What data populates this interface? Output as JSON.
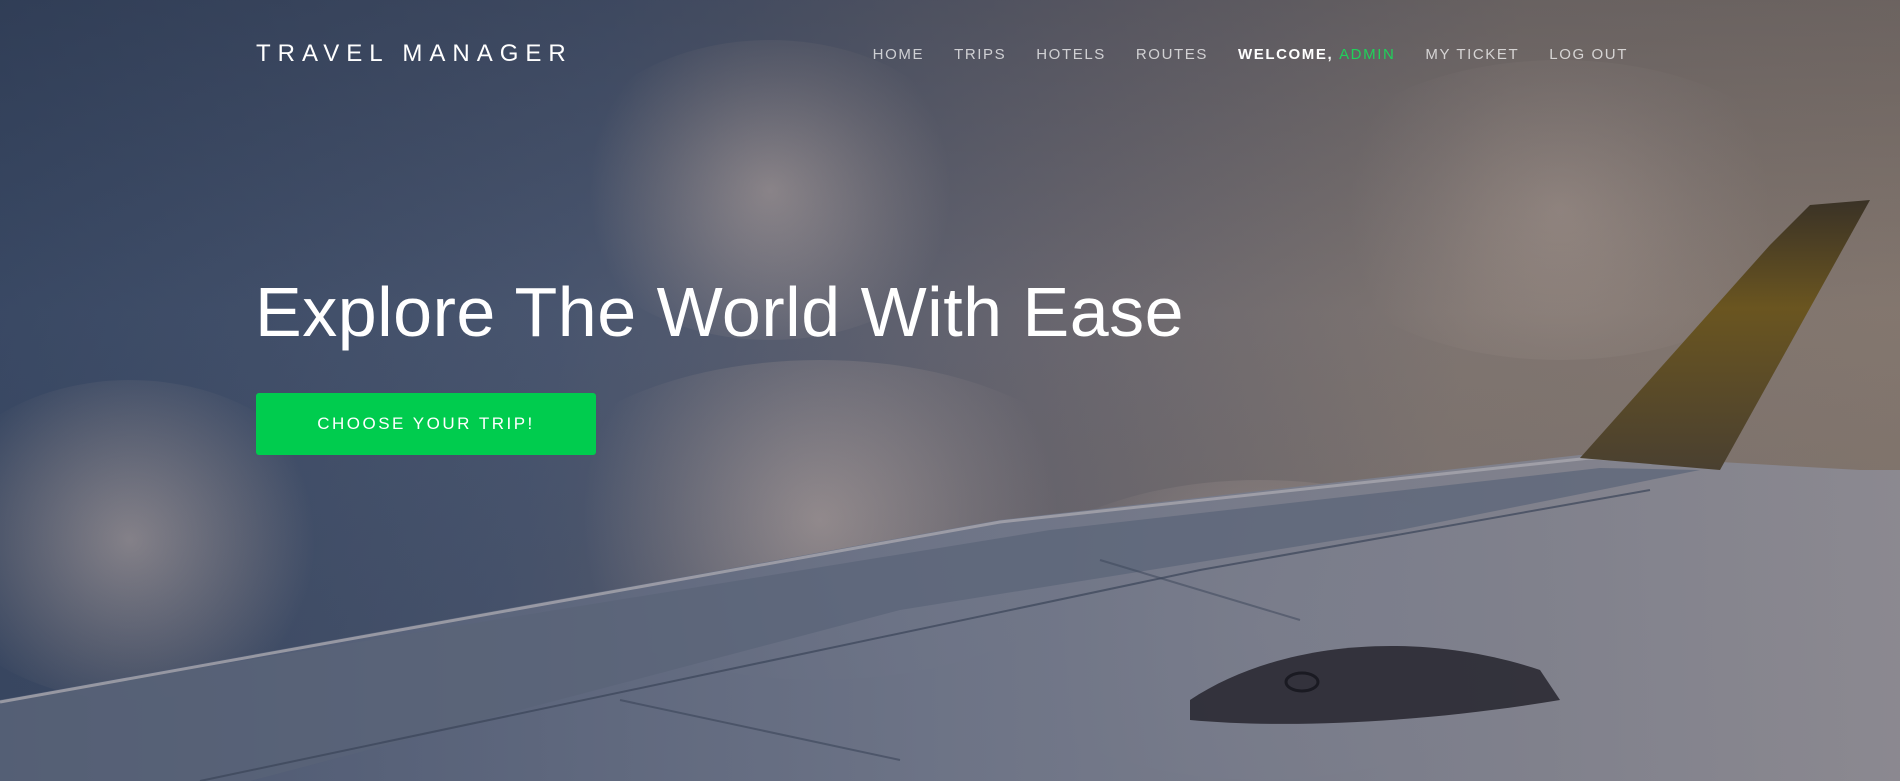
{
  "brand": "TRAVEL MANAGER",
  "nav": {
    "items": [
      {
        "label": "HOME"
      },
      {
        "label": "TRIPS"
      },
      {
        "label": "HOTELS"
      },
      {
        "label": "ROUTES"
      }
    ],
    "welcome_label": "WELCOME,",
    "username": "ADMIN",
    "my_ticket": "MY TICKET",
    "logout": "LOG OUT"
  },
  "hero": {
    "headline": "Explore The World With Ease",
    "cta_label": "CHOOSE YOUR TRIP!"
  },
  "colors": {
    "accent": "#00cc4e",
    "username": "#1fd25a",
    "text": "#ffffff"
  },
  "icons": []
}
